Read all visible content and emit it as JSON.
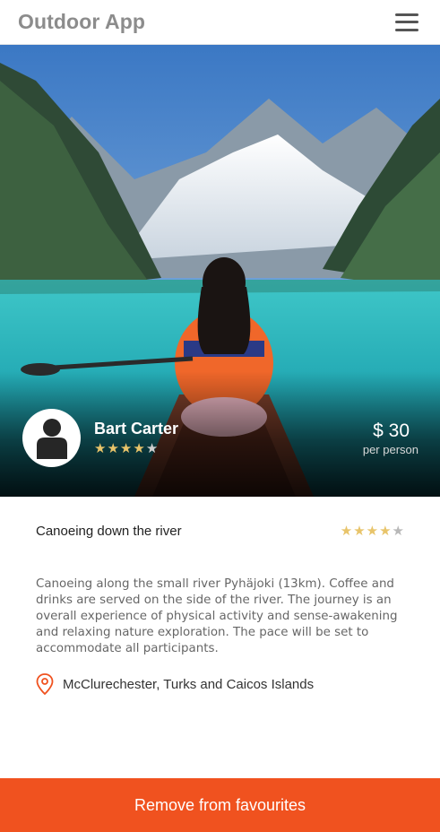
{
  "header": {
    "app_title": "Outdoor App",
    "menu_icon": "hamburger-menu-icon"
  },
  "hero": {
    "image_icon": "lake-canoe-photo",
    "host": {
      "name": "Bart Carter",
      "avatar_icon": "user-silhouette-icon",
      "rating": 3.5,
      "rating_max": 5
    },
    "price": {
      "amount": "$ 30",
      "unit": "per person"
    }
  },
  "activity": {
    "title": "Canoeing down the river",
    "rating": 4,
    "rating_max": 5,
    "description": "Canoeing along the small river Pyhäjoki (13km). Coffee and drinks are served on the side of the river. The journey is an overall experience of physical activity and sense-awakening and relaxing nature exploration. The pace will be set to accommodate all participants.",
    "location": "McClurechester, Turks and Caicos Islands",
    "location_icon": "map-pin-icon"
  },
  "actions": {
    "remove_favourite_label": "Remove from favourites"
  },
  "colors": {
    "accent": "#f0521f",
    "star_filled": "#e8c46a",
    "star_empty": "#b8b8b8",
    "title_grey": "#8c8c8c"
  }
}
